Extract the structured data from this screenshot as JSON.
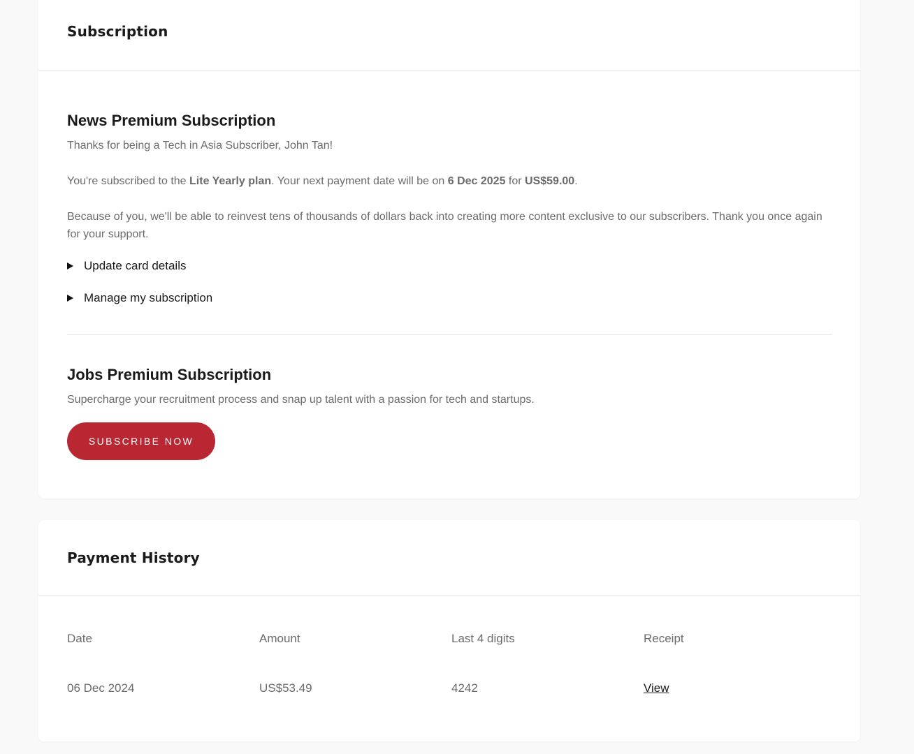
{
  "subscription_card": {
    "title": "Subscription",
    "news": {
      "title": "News Premium Subscription",
      "thanks": "Thanks for being a Tech in Asia Subscriber, John Tan!",
      "plan_prefix": "You're subscribed to the ",
      "plan_name": "Lite Yearly plan",
      "plan_mid": ". Your next payment date will be on ",
      "next_payment_date": "6 Dec 2025",
      "plan_for": " for ",
      "next_payment_amount": "US$59.00",
      "plan_suffix": ".",
      "reinvest": "Because of you, we'll be able to reinvest tens of thousands of dollars back into creating more content exclusive to our subscribers. Thank you once again for your support.",
      "update_card_label": "Update card details",
      "manage_label": "Manage my subscription"
    },
    "jobs": {
      "title": "Jobs Premium Subscription",
      "description": "Supercharge your recruitment process and snap up talent with a passion for tech and startups.",
      "subscribe_label": "SUBSCRIBE NOW"
    }
  },
  "payment_history": {
    "title": "Payment History",
    "columns": [
      "Date",
      "Amount",
      "Last 4 digits",
      "Receipt"
    ],
    "rows": [
      {
        "date": "06 Dec 2024",
        "amount": "US$53.49",
        "last4": "4242",
        "receipt": "View"
      }
    ]
  },
  "colors": {
    "accent": "#b92733",
    "text_primary": "#1a1a1a",
    "text_secondary": "#6b6b6b",
    "page_background": "#f9f9f9",
    "card_background": "#ffffff",
    "divider": "#e6e6e6"
  },
  "icons": {
    "disclosure": "triangle-right-icon"
  }
}
